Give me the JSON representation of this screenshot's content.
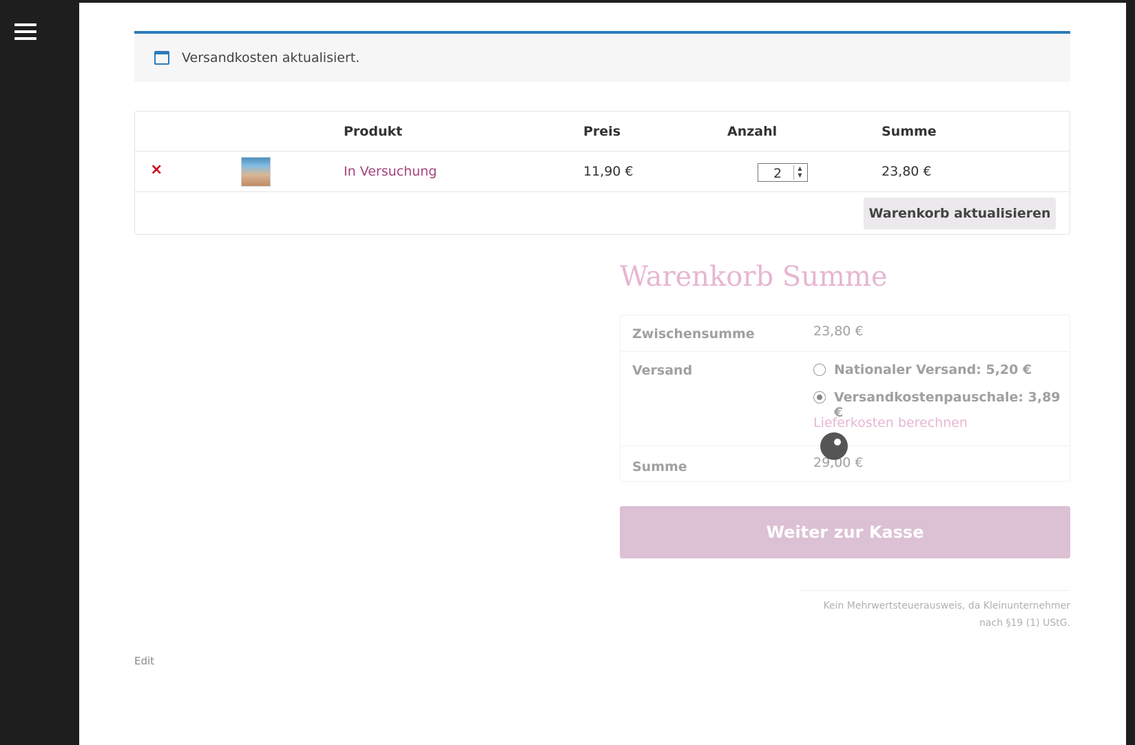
{
  "notice": {
    "text": "Versandkosten aktualisiert."
  },
  "cart": {
    "headers": {
      "product": "Produkt",
      "price": "Preis",
      "quantity": "Anzahl",
      "total": "Summe"
    },
    "items": [
      {
        "remove": "×",
        "name": "In Versuchung",
        "price": "11,90 €",
        "quantity": "2",
        "total": "23,80 €"
      }
    ],
    "update_button": "Warenkorb aktualisieren"
  },
  "totals": {
    "title": "Warenkorb Summe",
    "subtotal_label": "Zwischensumme",
    "subtotal_value": "23,80 €",
    "shipping_label": "Versand",
    "shipping_options": [
      {
        "label": "Nationaler Versand: 5,20 €",
        "checked": false
      },
      {
        "label": "Versandkostenpauschale: 3,89 €",
        "checked": true
      }
    ],
    "calc_shipping": "Lieferkosten berechnen",
    "total_label": "Summe",
    "total_value": "29,00 €"
  },
  "checkout_button": "Weiter zur Kasse",
  "vat_note_line1": "Kein Mehrwertsteuerausweis, da Kleinunternehmer",
  "vat_note_line2": "nach §19 (1) UStG.",
  "edit_link": "Edit",
  "colors": {
    "accent": "#2b7bb9",
    "link": "#a3447b",
    "pink_light": "#e6b6d1",
    "checkout_bg": "#dcc0d4",
    "remove": "#d0021b"
  }
}
